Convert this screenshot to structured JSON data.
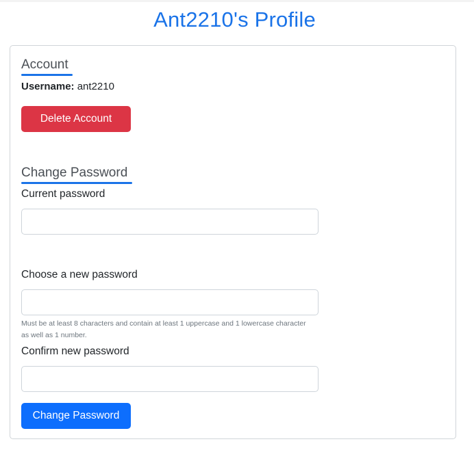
{
  "page": {
    "title": "Ant2210's Profile"
  },
  "account": {
    "heading": "Account",
    "username_label": "Username:",
    "username_value": "ant2210",
    "delete_button": "Delete Account"
  },
  "change_password": {
    "heading": "Change Password",
    "current_label": "Current password",
    "current_value": "",
    "new_label": "Choose a new password",
    "new_value": "",
    "new_help": "Must be at least 8 characters and contain at least 1 uppercase and 1 lowercase character as well as 1 number.",
    "confirm_label": "Confirm new password",
    "confirm_value": "",
    "submit_button": "Change Password"
  },
  "colors": {
    "title": "#1a73e8",
    "heading_underline": "#1a73e8",
    "danger": "#dc3545",
    "primary": "#0d6efd"
  }
}
